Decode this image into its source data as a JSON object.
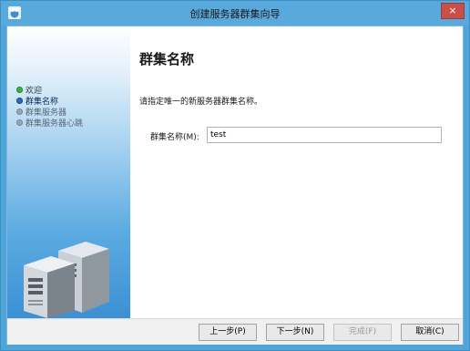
{
  "window": {
    "title": "创建服务器群集向导",
    "close_glyph": "×",
    "accent": "#4fa5d8"
  },
  "sidebar": {
    "steps": [
      {
        "label": "欢迎",
        "state": "done"
      },
      {
        "label": "群集名称",
        "state": "current"
      },
      {
        "label": "群集服务器",
        "state": "pending"
      },
      {
        "label": "群集服务器心跳",
        "state": "pending"
      }
    ],
    "illustration": "server-icon"
  },
  "main": {
    "heading": "群集名称",
    "instruction": "请指定唯一的新服务器群集名称。",
    "cluster_name_label": "群集名称(M):",
    "cluster_name_value": "test"
  },
  "buttons": {
    "back": "上一步(P)",
    "next": "下一步(N)",
    "finish": "完成(F)",
    "cancel": "取消(C)"
  }
}
